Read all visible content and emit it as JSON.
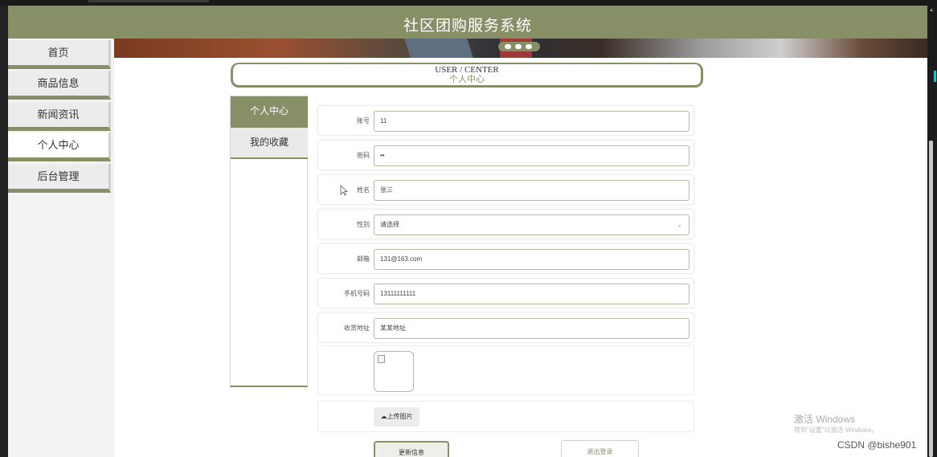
{
  "app": {
    "title": "社区团购服务系统"
  },
  "colors": {
    "accent": "#878f67",
    "header_bg": "#878f67",
    "sidebar_bg": "#f3f3f3"
  },
  "sidebar": {
    "items": [
      {
        "label": "首页",
        "active": false
      },
      {
        "label": "商品信息",
        "active": false
      },
      {
        "label": "新闻资讯",
        "active": false
      },
      {
        "label": "个人中心",
        "active": true
      },
      {
        "label": "后台管理",
        "active": false
      }
    ]
  },
  "banner": {
    "slide_count": 3
  },
  "center": {
    "title_en": "USER / CENTER",
    "title_cn": "个人中心"
  },
  "subnav": {
    "items": [
      {
        "label": "个人中心",
        "active": true
      },
      {
        "label": "我的收藏",
        "active": false
      }
    ]
  },
  "form": {
    "fields": [
      {
        "label": "账号",
        "value": "11",
        "type": "text"
      },
      {
        "label": "密码",
        "value": "••",
        "type": "password"
      },
      {
        "label": "姓名",
        "value": "张三",
        "type": "text"
      },
      {
        "label": "性别",
        "value": "请选择",
        "type": "select"
      },
      {
        "label": "邮箱",
        "value": "131@163.com",
        "type": "text"
      },
      {
        "label": "手机号码",
        "value": "13111111111",
        "type": "text"
      },
      {
        "label": "收货地址",
        "value": "某某地址",
        "type": "text"
      }
    ],
    "upload_label": "上传图片",
    "update_label": "更新信息",
    "logout_label": "退出登录",
    "icons": {
      "upload": "cloud-upload-icon",
      "select": "chevron-down-icon",
      "image": "broken-image-icon",
      "pointer": "mouse-pointer-icon"
    }
  },
  "watermark": {
    "title": "激活 Windows",
    "subtitle": "转到\"设置\"以激活 Windows。",
    "csdn": "CSDN @bishe901"
  }
}
